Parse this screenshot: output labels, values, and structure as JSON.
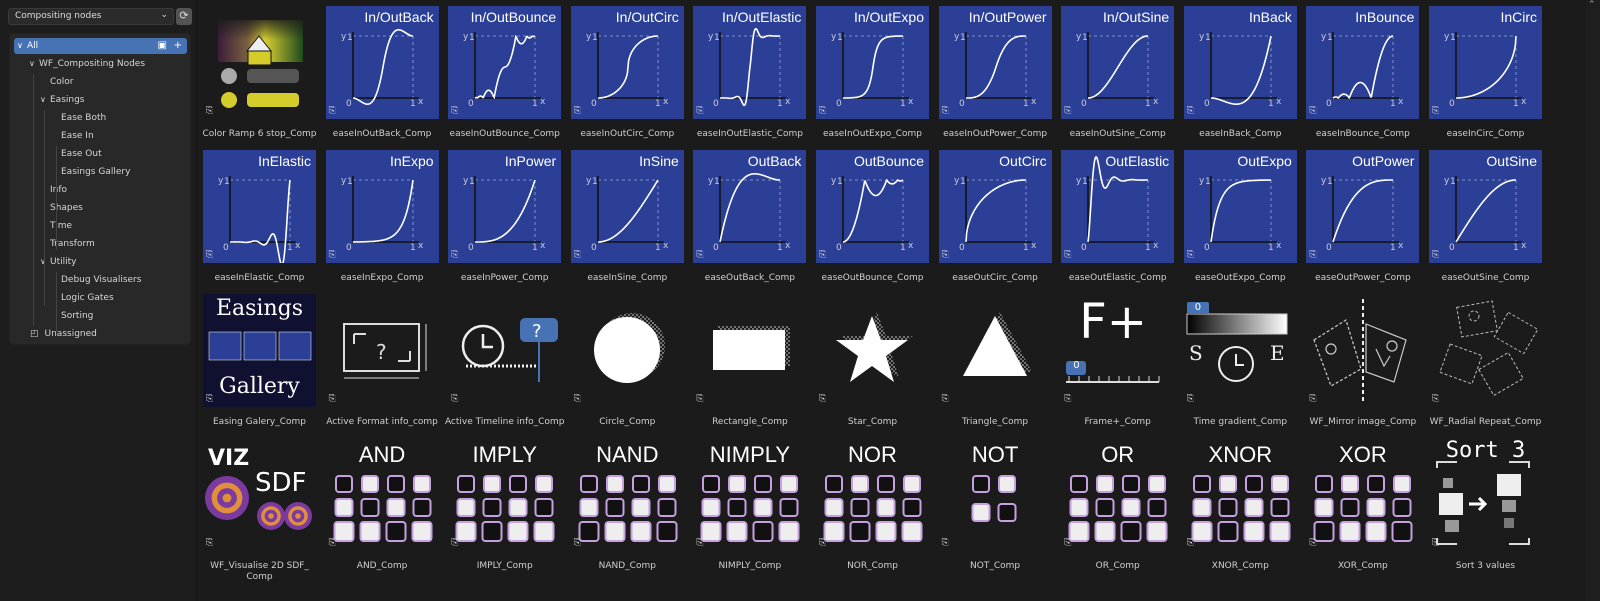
{
  "library_selector": {
    "value": "Compositing nodes",
    "refresh_icon": "refresh-icon"
  },
  "tree": {
    "all": "All",
    "items": [
      {
        "label": "WF_Compositing Nodes",
        "level": 1,
        "expanded": true
      },
      {
        "label": "Color",
        "level": 2
      },
      {
        "label": "Easings",
        "level": 2,
        "expanded": true
      },
      {
        "label": "Ease Both",
        "level": 3
      },
      {
        "label": "Ease In",
        "level": 3
      },
      {
        "label": "Ease Out",
        "level": 3
      },
      {
        "label": "Easings Gallery",
        "level": 3
      },
      {
        "label": "Info",
        "level": 2
      },
      {
        "label": "Shapes",
        "level": 2
      },
      {
        "label": "Time",
        "level": 2
      },
      {
        "label": "Transform",
        "level": 2
      },
      {
        "label": "Utility",
        "level": 2,
        "expanded": true
      },
      {
        "label": "Debug Visualisers",
        "level": 3
      },
      {
        "label": "Logic Gates",
        "level": 3
      },
      {
        "label": "Sorting",
        "level": 3
      }
    ],
    "unassigned": "Unassigned"
  },
  "assets": [
    {
      "name": "Color Ramp 6 stop_Comp",
      "kind": "ramp"
    },
    {
      "name": "easeInOutBack_Comp",
      "kind": "ease",
      "title": "In/OutBack",
      "fn": "inOutBack"
    },
    {
      "name": "easeInOutBounce_Comp",
      "kind": "ease",
      "title": "In/OutBounce",
      "fn": "inOutBounce"
    },
    {
      "name": "easeInOutCirc_Comp",
      "kind": "ease",
      "title": "In/OutCirc",
      "fn": "inOutCirc"
    },
    {
      "name": "easeInOutElastic_Comp",
      "kind": "ease",
      "title": "In/OutElastic",
      "fn": "inOutElastic"
    },
    {
      "name": "easeInOutExpo_Comp",
      "kind": "ease",
      "title": "In/OutExpo",
      "fn": "inOutExpo"
    },
    {
      "name": "easeInOutPower_Comp",
      "kind": "ease",
      "title": "In/OutPower",
      "fn": "inOutPower"
    },
    {
      "name": "easeInOutSine_Comp",
      "kind": "ease",
      "title": "In/OutSine",
      "fn": "inOutSine"
    },
    {
      "name": "easeInBack_Comp",
      "kind": "ease",
      "title": "InBack",
      "fn": "inBack"
    },
    {
      "name": "easeInBounce_Comp",
      "kind": "ease",
      "title": "InBounce",
      "fn": "inBounce"
    },
    {
      "name": "easeInCirc_Comp",
      "kind": "ease",
      "title": "InCirc",
      "fn": "inCirc"
    },
    {
      "name": "easeInElastic_Comp",
      "kind": "ease",
      "title": "InElastic",
      "fn": "inElastic"
    },
    {
      "name": "easeInExpo_Comp",
      "kind": "ease",
      "title": "InExpo",
      "fn": "inExpo"
    },
    {
      "name": "easeInPower_Comp",
      "kind": "ease",
      "title": "InPower",
      "fn": "inPower"
    },
    {
      "name": "easeInSine_Comp",
      "kind": "ease",
      "title": "InSine",
      "fn": "inSine"
    },
    {
      "name": "easeOutBack_Comp",
      "kind": "ease",
      "title": "OutBack",
      "fn": "outBack"
    },
    {
      "name": "easeOutBounce_Comp",
      "kind": "ease",
      "title": "OutBounce",
      "fn": "outBounce"
    },
    {
      "name": "easeOutCirc_Comp",
      "kind": "ease",
      "title": "OutCirc",
      "fn": "outCirc"
    },
    {
      "name": "easeOutElastic_Comp",
      "kind": "ease",
      "title": "OutElastic",
      "fn": "outElastic"
    },
    {
      "name": "easeOutExpo_Comp",
      "kind": "ease",
      "title": "OutExpo",
      "fn": "outExpo"
    },
    {
      "name": "easeOutPower_Comp",
      "kind": "ease",
      "title": "OutPower",
      "fn": "outPower"
    },
    {
      "name": "easeOutSine_Comp",
      "kind": "ease",
      "title": "OutSine",
      "fn": "outSine"
    },
    {
      "name": "Easing Galery_Comp",
      "kind": "gallery",
      "title": "Easings",
      "subtitle": "Gallery"
    },
    {
      "name": "Active Format info_comp",
      "kind": "format",
      "title": "?"
    },
    {
      "name": "Active Timeline info_Comp",
      "kind": "timeline",
      "title": "?"
    },
    {
      "name": "Circle_Comp",
      "kind": "circle"
    },
    {
      "name": "Rectangle_Comp",
      "kind": "rect"
    },
    {
      "name": "Star_Comp",
      "kind": "star"
    },
    {
      "name": "Triangle_Comp",
      "kind": "tri"
    },
    {
      "name": "Frame+_Comp",
      "kind": "frame",
      "title": "F+",
      "subtitle": "0"
    },
    {
      "name": "Time gradient_Comp",
      "kind": "tgrad",
      "title": "0",
      "subtitle": "S    E"
    },
    {
      "name": "WF_Mirror image_Comp",
      "kind": "mirror"
    },
    {
      "name": "WF_Radial Repeat_Comp",
      "kind": "radial"
    },
    {
      "name": "WF_Visualise 2D SDF_ Comp",
      "kind": "sdf",
      "title": "VIZ",
      "subtitle": "SDF"
    },
    {
      "name": "AND_Comp",
      "kind": "gate",
      "title": "AND",
      "cols": 4
    },
    {
      "name": "IMPLY_Comp",
      "kind": "gate",
      "title": "IMPLY",
      "cols": 4
    },
    {
      "name": "NAND_Comp",
      "kind": "gate",
      "title": "NAND",
      "cols": 4
    },
    {
      "name": "NIMPLY_Comp",
      "kind": "gate",
      "title": "NIMPLY",
      "cols": 4
    },
    {
      "name": "NOR_Comp",
      "kind": "gate",
      "title": "NOR",
      "cols": 4
    },
    {
      "name": "NOT_Comp",
      "kind": "gate",
      "title": "NOT",
      "cols": 2
    },
    {
      "name": "OR_Comp",
      "kind": "gate",
      "title": "OR",
      "cols": 4
    },
    {
      "name": "XNOR_Comp",
      "kind": "gate",
      "title": "XNOR",
      "cols": 4
    },
    {
      "name": "XOR_Comp",
      "kind": "gate",
      "title": "XOR",
      "cols": 4
    },
    {
      "name": "Sort 3 values",
      "kind": "sort",
      "title": "Sort 3"
    }
  ],
  "colors": {
    "accent": "#4772b3",
    "thumb_blue": "#2b3f96",
    "gate_border": "#c7a0e0"
  }
}
